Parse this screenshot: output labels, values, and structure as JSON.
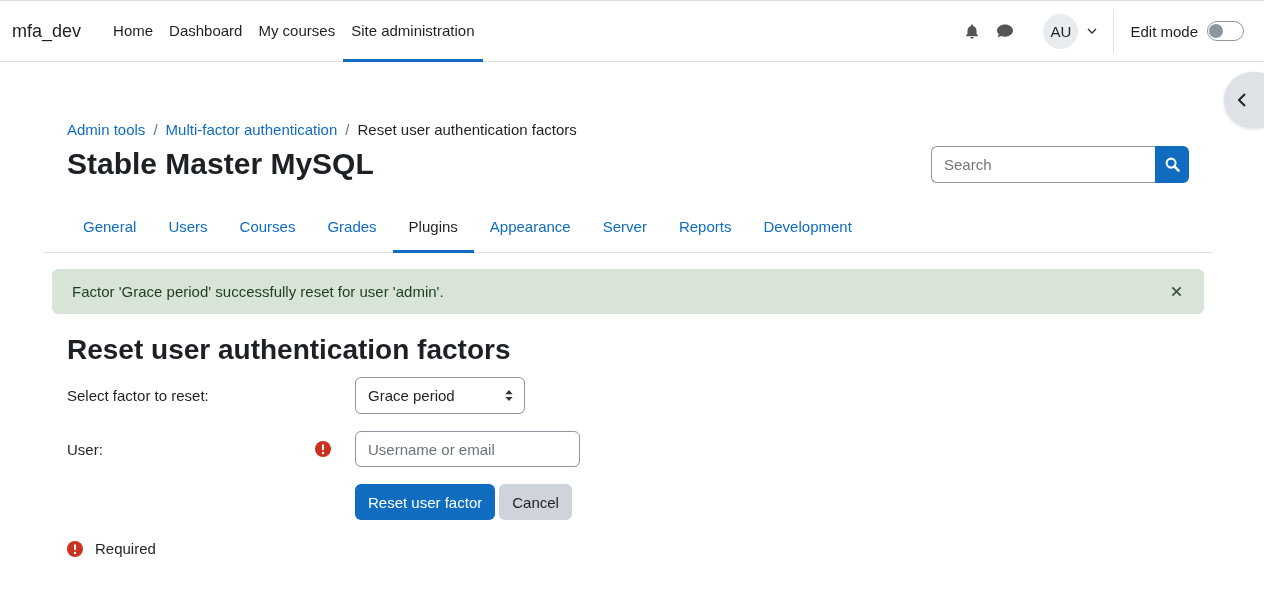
{
  "site_name": "mfa_dev",
  "nav": [
    {
      "label": "Home",
      "selected": false
    },
    {
      "label": "Dashboard",
      "selected": false
    },
    {
      "label": "My courses",
      "selected": false
    },
    {
      "label": "Site administration",
      "selected": true
    }
  ],
  "user": {
    "initials": "AU"
  },
  "edit_mode": {
    "label": "Edit mode",
    "on": false
  },
  "breadcrumbs": [
    {
      "label": "Admin tools",
      "link": true
    },
    {
      "separator": "/",
      "label": "Multi-factor authentication",
      "link": true
    },
    {
      "separator": "/",
      "label": "Reset user authentication factors",
      "link": false
    }
  ],
  "page_title": "Stable Master MySQL",
  "search": {
    "placeholder": "Search"
  },
  "tabs": [
    {
      "label": "General",
      "selected": false
    },
    {
      "label": "Users",
      "selected": false
    },
    {
      "label": "Courses",
      "selected": false
    },
    {
      "label": "Grades",
      "selected": false
    },
    {
      "label": "Plugins",
      "selected": true
    },
    {
      "label": "Appearance",
      "selected": false
    },
    {
      "label": "Server",
      "selected": false
    },
    {
      "label": "Reports",
      "selected": false
    },
    {
      "label": "Development",
      "selected": false
    }
  ],
  "alert": {
    "kind": "success",
    "message": "Factor 'Grace period' successfully reset for user 'admin'."
  },
  "heading": "Reset user authentication factors",
  "form": {
    "fields": [
      {
        "kind": "select",
        "label": "Select factor to reset:",
        "value": "Grace period",
        "required": false
      },
      {
        "kind": "text",
        "label": "User:",
        "placeholder": "Username or email",
        "required": true
      }
    ],
    "buttons": [
      {
        "label": "Reset user factor",
        "kind": "primary"
      },
      {
        "label": "Cancel",
        "kind": "secondary"
      }
    ],
    "required_note": "Required"
  }
}
